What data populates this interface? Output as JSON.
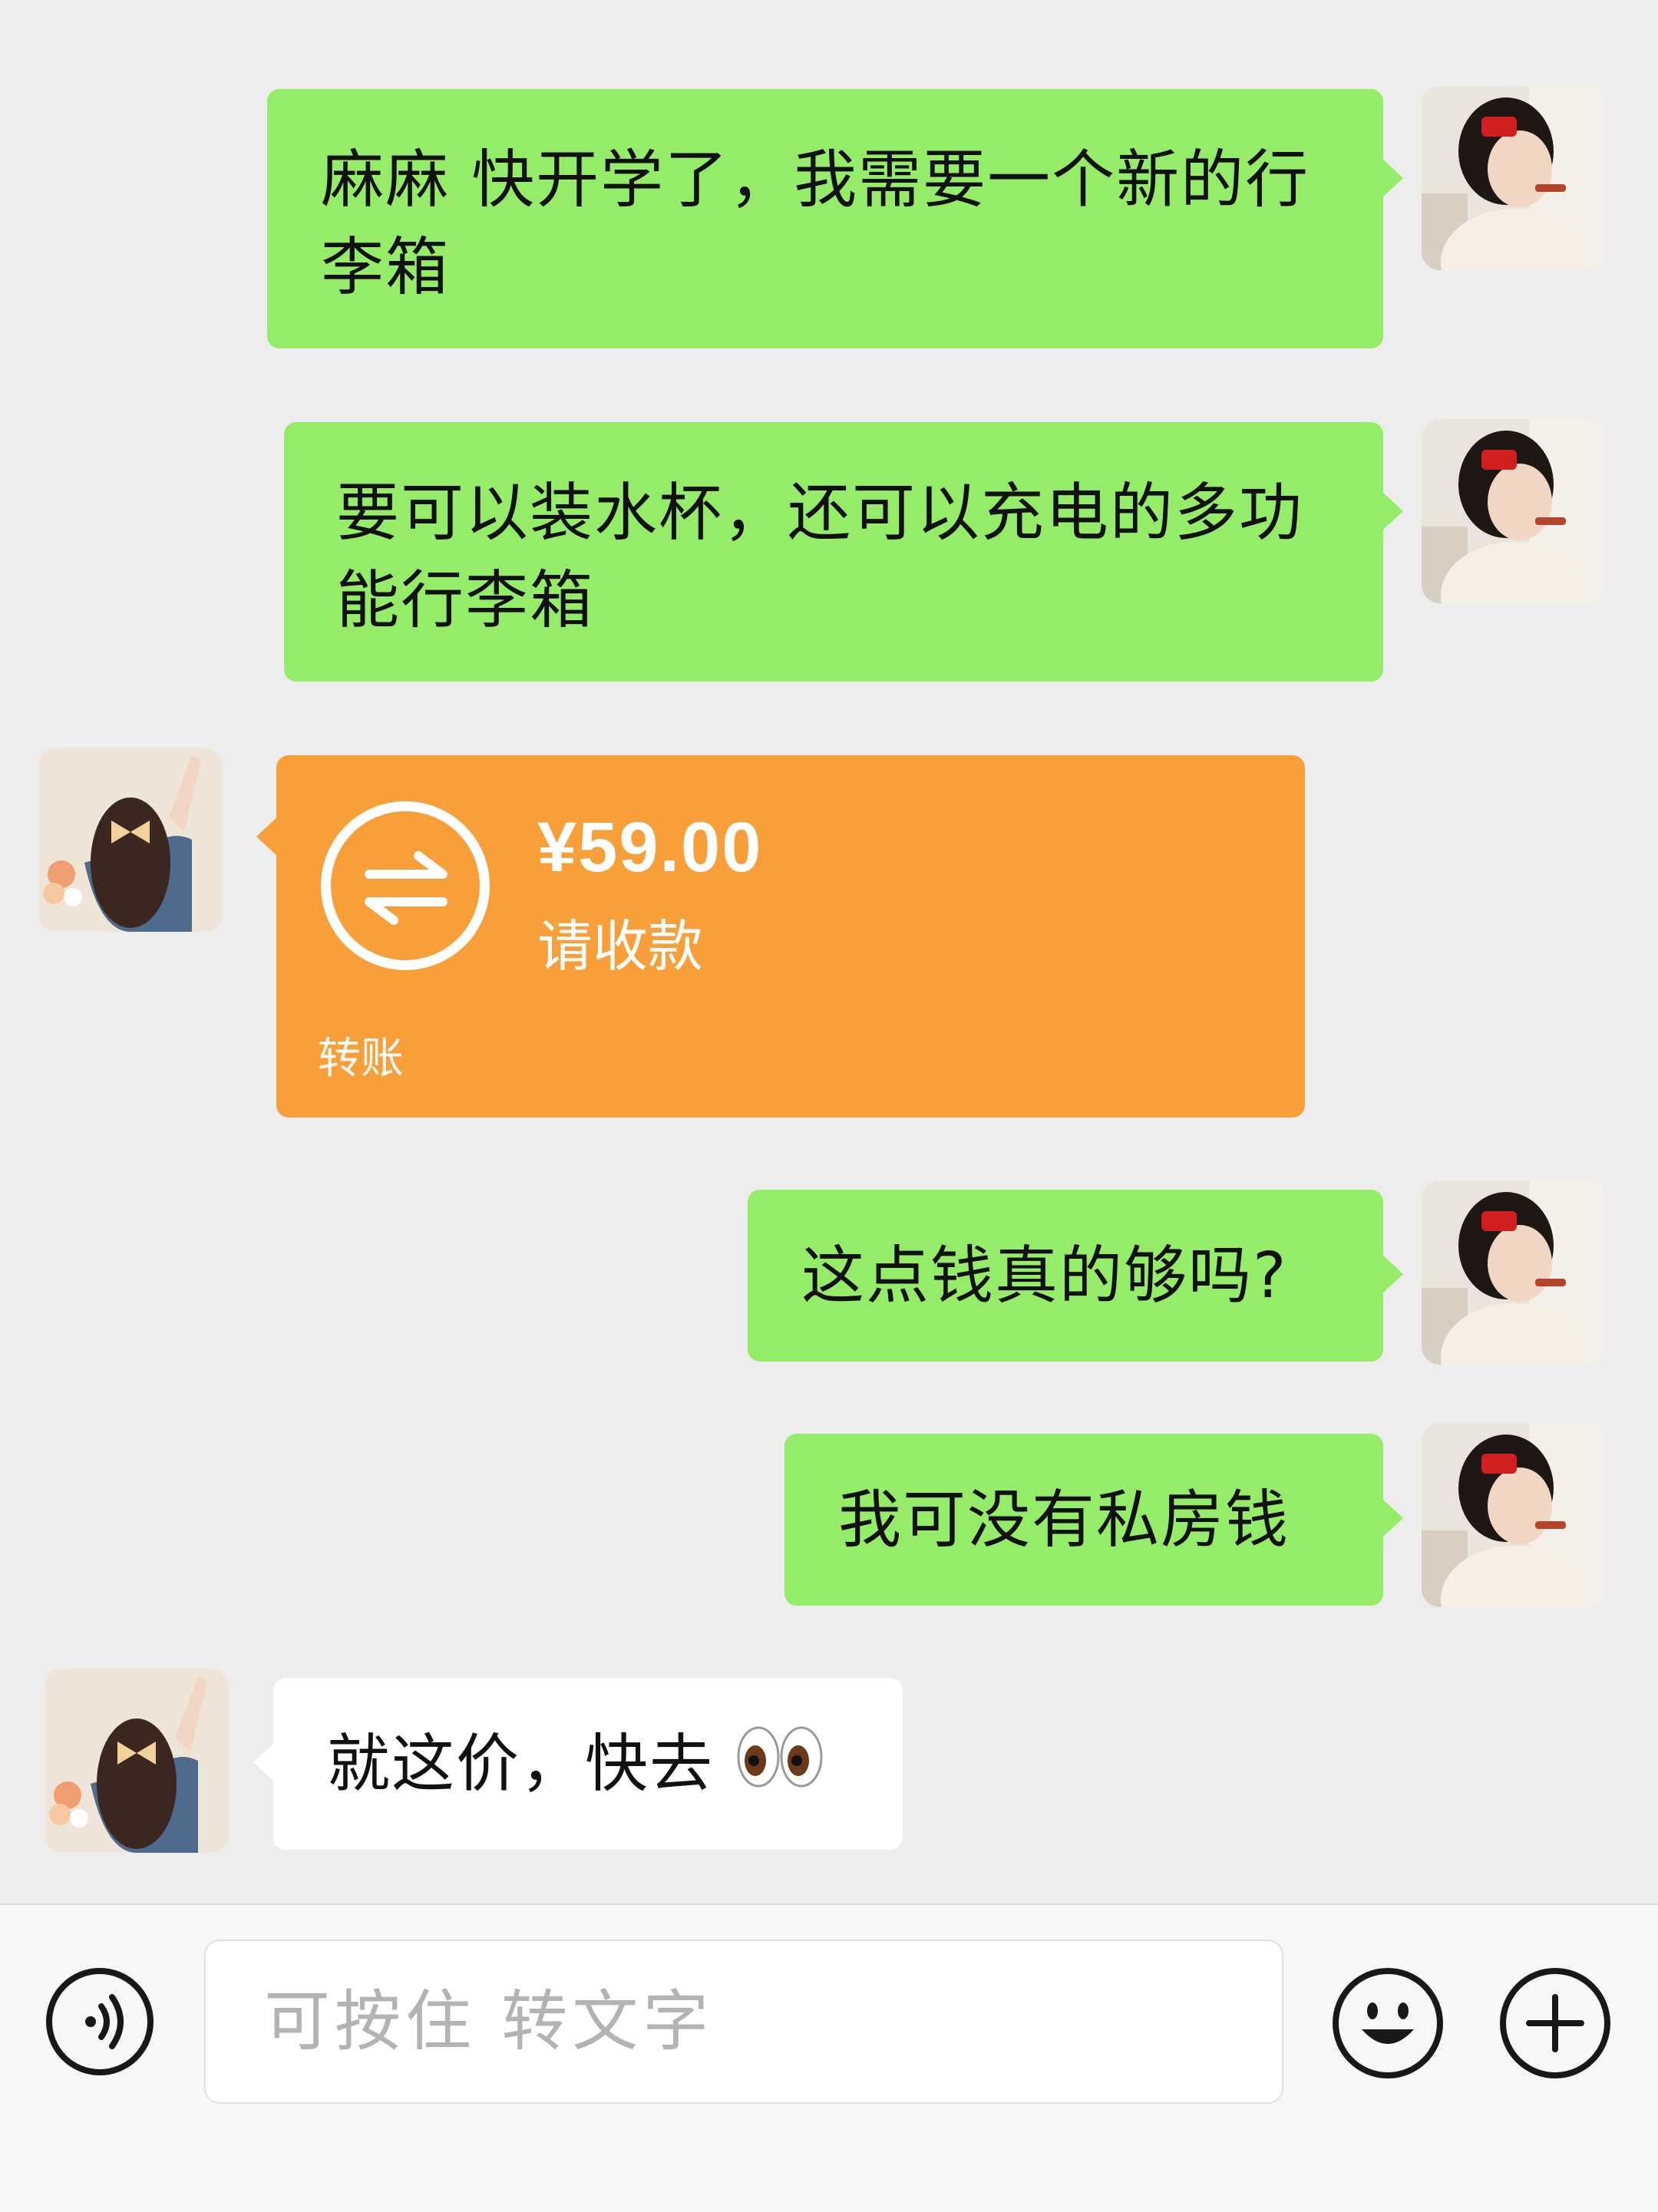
{
  "messages": [
    {
      "side": "right",
      "type": "text",
      "text": "麻麻 快开学了，我需要一个新的行李箱"
    },
    {
      "side": "right",
      "type": "text",
      "text": "要可以装水杯，还可以充电的多功能行李箱"
    },
    {
      "side": "left",
      "type": "transfer",
      "amount": "¥59.00",
      "status": "请收款",
      "label": "转账"
    },
    {
      "side": "right",
      "type": "text",
      "text": "这点钱真的够吗?"
    },
    {
      "side": "right",
      "type": "text",
      "text": "我可没有私房钱"
    },
    {
      "side": "left",
      "type": "text",
      "text": "就这价，快去",
      "emoji": "eyes-emoji"
    }
  ],
  "input_bar": {
    "placeholder": "可按住 转文字",
    "voice_icon": "voice-icon",
    "emoji_icon": "smiley-icon",
    "plus_icon": "plus-icon"
  },
  "colors": {
    "green_bubble": "#95ec69",
    "transfer": "#f89f3a",
    "background": "#ededed"
  }
}
